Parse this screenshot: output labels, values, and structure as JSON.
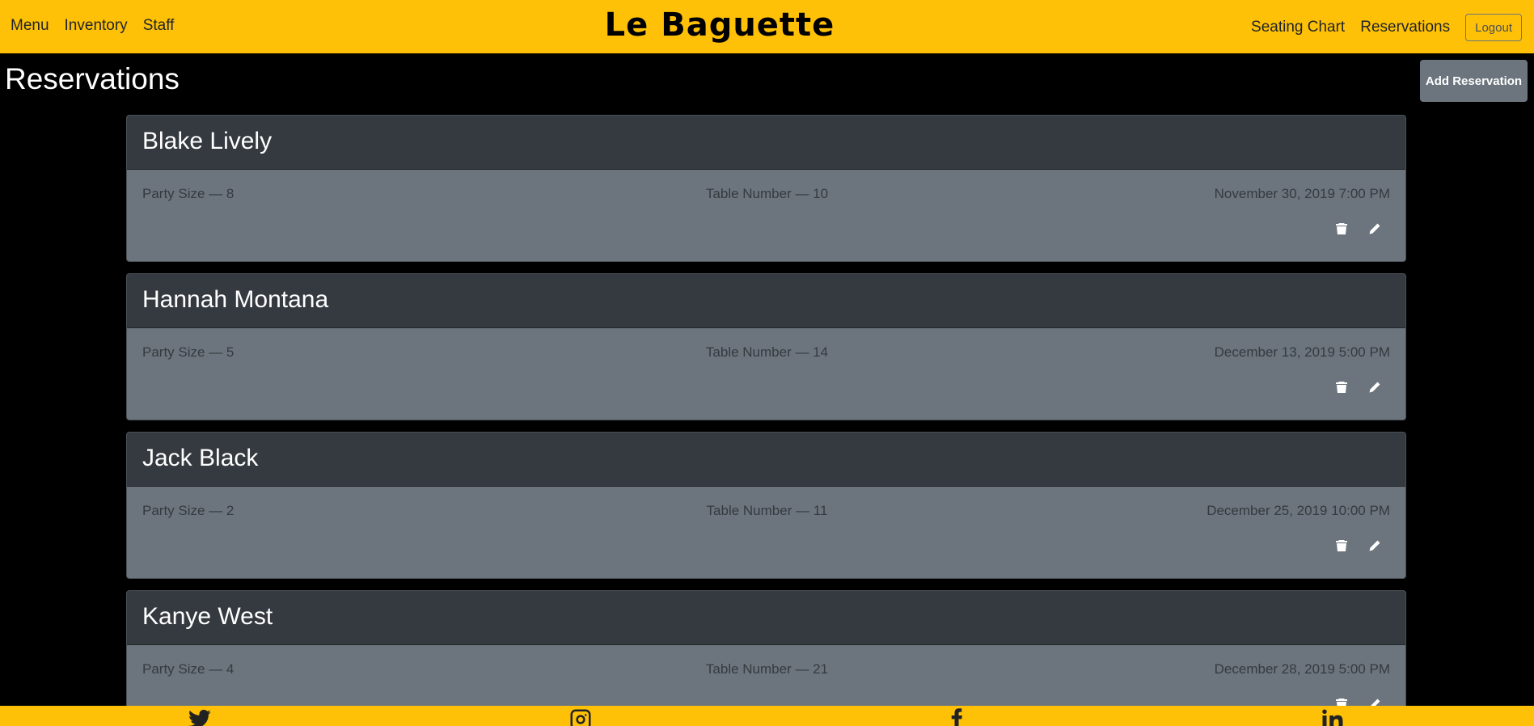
{
  "navbar": {
    "left_links": [
      "Menu",
      "Inventory",
      "Staff"
    ],
    "brand": "Le Baguette",
    "right_links": [
      "Seating Chart",
      "Reservations"
    ],
    "logout_label": "Logout"
  },
  "page": {
    "title": "Reservations",
    "add_button_label": "Add Reservation"
  },
  "reservations": [
    {
      "name": "Blake Lively",
      "party": "Party Size — 8",
      "table": "Table Number — 10",
      "datetime": "November 30, 2019 7:00 PM"
    },
    {
      "name": "Hannah Montana",
      "party": "Party Size — 5",
      "table": "Table Number — 14",
      "datetime": "December 13, 2019 5:00 PM"
    },
    {
      "name": "Jack Black",
      "party": "Party Size — 2",
      "table": "Table Number — 11",
      "datetime": "December 25, 2019 10:00 PM"
    },
    {
      "name": "Kanye West",
      "party": "Party Size — 4",
      "table": "Table Number — 21",
      "datetime": "December 28, 2019 5:00 PM"
    }
  ],
  "actions": {
    "delete_icon": "trash-icon",
    "edit_icon": "pencil-icon"
  },
  "footer": {
    "icons": [
      "twitter-icon",
      "instagram-icon",
      "facebook-icon",
      "linkedin-icon"
    ]
  },
  "colors": {
    "accent": "#ffc107",
    "card_header": "#343a40",
    "card_body": "#6c757d",
    "background": "#000000"
  }
}
